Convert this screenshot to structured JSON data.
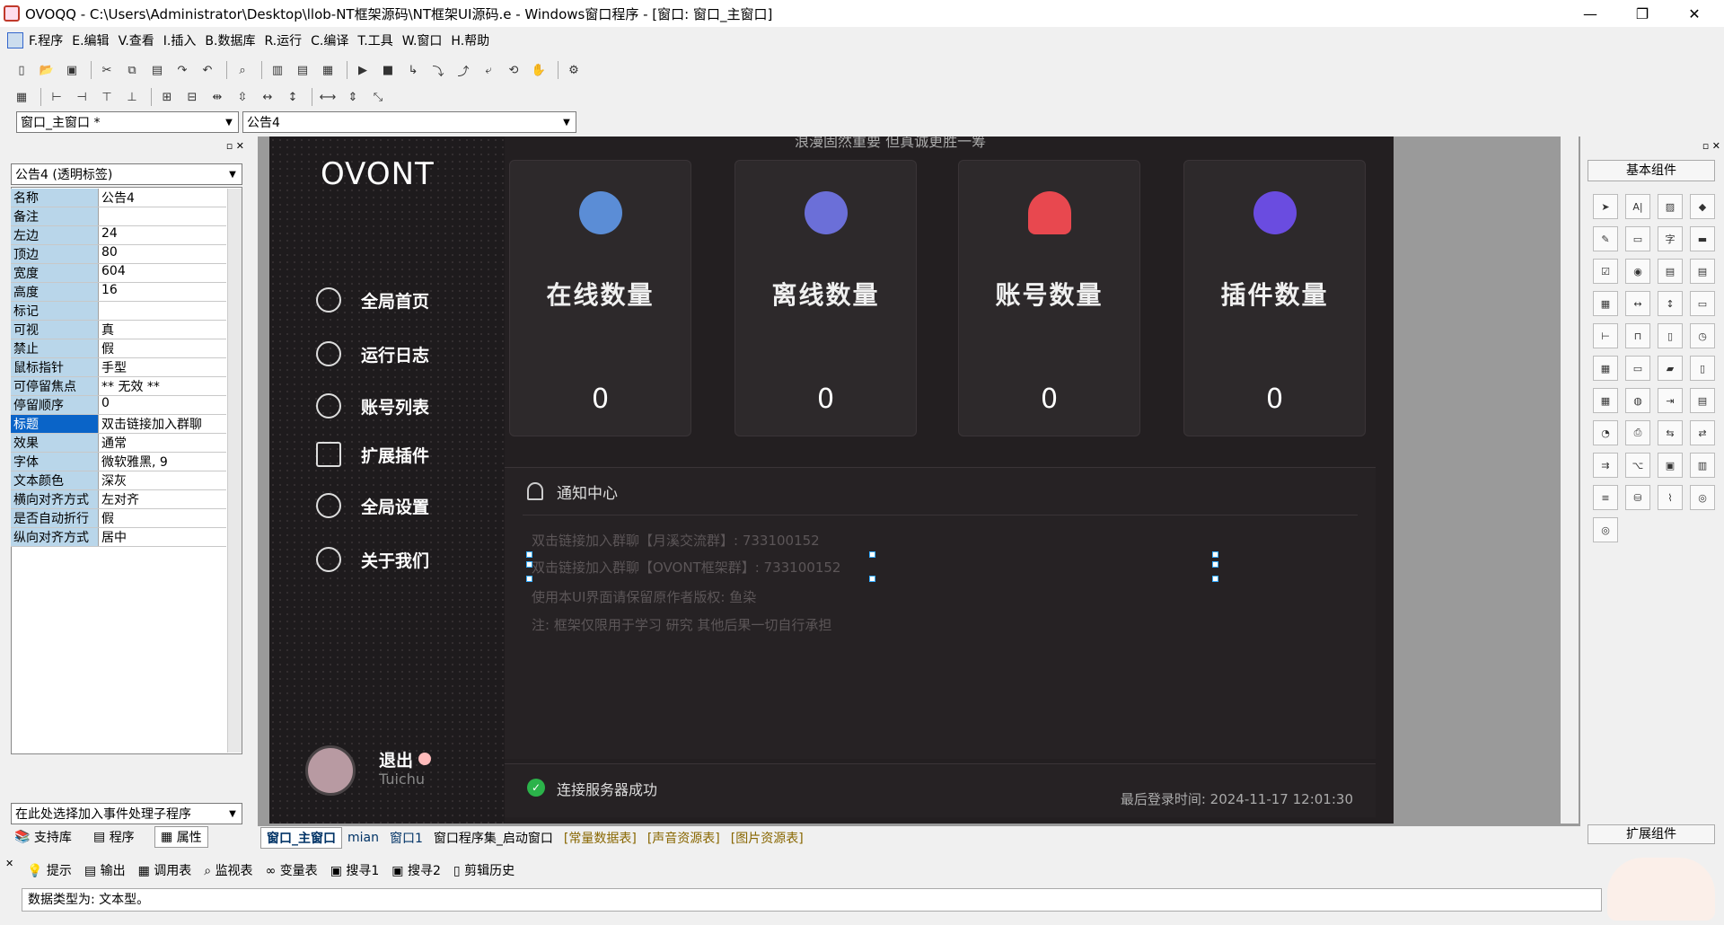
{
  "window": {
    "title": "OVOQQ - C:\\Users\\Administrator\\Desktop\\llob-NT框架源码\\NT框架UI源码.e - Windows窗口程序 - [窗口: 窗口_主窗口]",
    "minimize": "—",
    "restore": "❐",
    "close": "✕"
  },
  "menu": [
    "F.程序",
    "E.编辑",
    "V.查看",
    "I.插入",
    "B.数据库",
    "R.运行",
    "C.编译",
    "T.工具",
    "W.窗口",
    "H.帮助"
  ],
  "toolbar": {
    "window_combo": "窗口_主窗口 *",
    "control_combo": "公告4"
  },
  "props": {
    "object_combo": "公告4 (透明标签)",
    "rows": [
      {
        "name": "名称",
        "value": "公告4"
      },
      {
        "name": "备注",
        "value": ""
      },
      {
        "name": "左边",
        "value": "24"
      },
      {
        "name": "顶边",
        "value": "80"
      },
      {
        "name": "宽度",
        "value": "604"
      },
      {
        "name": "高度",
        "value": "16"
      },
      {
        "name": "标记",
        "value": ""
      },
      {
        "name": "可视",
        "value": "真"
      },
      {
        "name": "禁止",
        "value": "假"
      },
      {
        "name": "鼠标指针",
        "value": "手型"
      },
      {
        "name": "可停留焦点",
        "value": "** 无效 **"
      },
      {
        "name": "停留顺序",
        "value": "0"
      },
      {
        "name": "标题",
        "value": "双击链接加入群聊"
      },
      {
        "name": "效果",
        "value": "通常"
      },
      {
        "name": "字体",
        "value": "微软雅黑, 9"
      },
      {
        "name": "文本颜色",
        "value": "深灰"
      },
      {
        "name": "横向对齐方式",
        "value": "左对齐"
      },
      {
        "name": "是否自动折行",
        "value": "假"
      },
      {
        "name": "纵向对齐方式",
        "value": "居中"
      }
    ],
    "event_combo": "在此处选择加入事件处理子程序",
    "tabs": [
      "支持库",
      "程序",
      "属性"
    ]
  },
  "app": {
    "top_text": "浪漫固然重要 但真诚更胜一筹",
    "logo": "OVONT",
    "nav": [
      "全局首页",
      "运行日志",
      "账号列表",
      "扩展插件",
      "全局设置",
      "关于我们"
    ],
    "cards": [
      {
        "label": "在线数量",
        "value": "0",
        "color": "#5b8dd6"
      },
      {
        "label": "离线数量",
        "value": "0",
        "color": "#6b6fd8"
      },
      {
        "label": "账号数量",
        "value": "0",
        "color": "#e8484f"
      },
      {
        "label": "插件数量",
        "value": "0",
        "color": "#6a4ce0"
      }
    ],
    "notice": {
      "title": "通知中心",
      "lines": [
        "双击链接加入群聊【月溪交流群】: 733100152",
        "双击链接加入群聊【OVONT框架群】: 733100152",
        "使用本UI界面请保留原作者版权: 鱼染",
        "注: 框架仅限用于学习 研究 其他后果一切自行承担"
      ]
    },
    "user": {
      "name": "退出",
      "sub": "Tuichu"
    },
    "status": {
      "text": "连接服务器成功",
      "time": "最后登录时间: 2024-11-17 12:01:30"
    }
  },
  "right": {
    "title": "基本组件",
    "footer": "扩展组件"
  },
  "design_tabs": [
    "窗口_主窗口",
    "mian",
    "窗口1",
    "窗口程序集_启动窗口",
    "[常量数据表]",
    "[声音资源表]",
    "[图片资源表]"
  ],
  "bottom": {
    "tabs": [
      "提示",
      "输出",
      "调用表",
      "监视表",
      "变量表",
      "搜寻1",
      "搜寻2",
      "剪辑历史"
    ],
    "message": "数据类型为: 文本型。"
  }
}
